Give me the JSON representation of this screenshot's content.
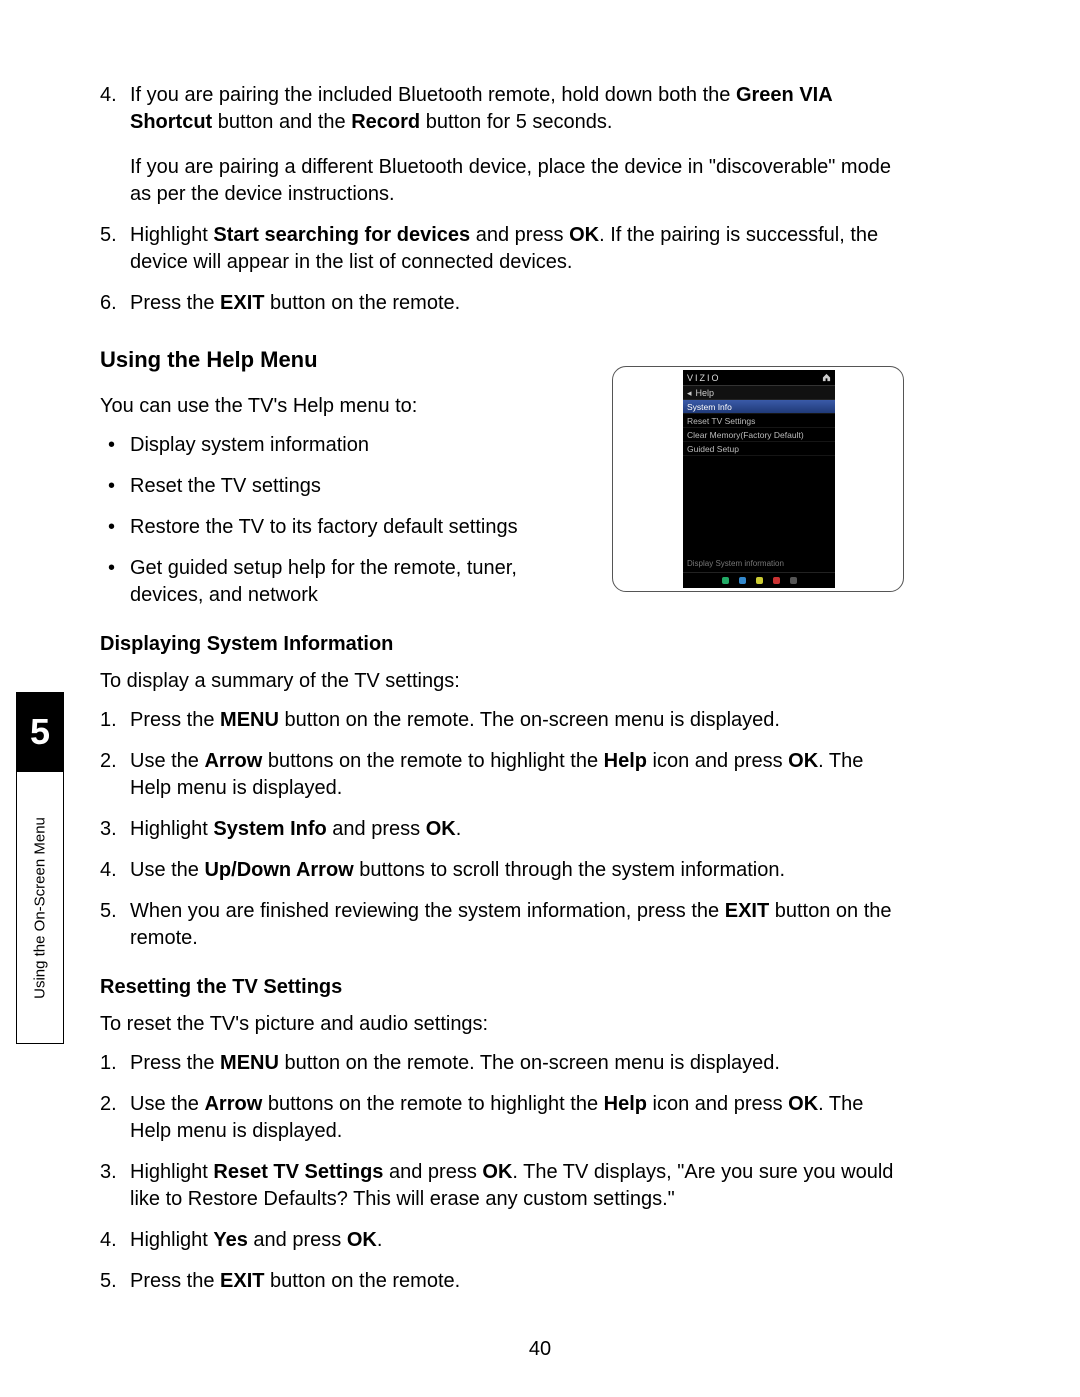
{
  "side": {
    "chapter": "5",
    "label": "Using the On-Screen Menu"
  },
  "steps_top": [
    {
      "n": "4.",
      "text": "If you are pairing the included Bluetooth remote, hold down both the ",
      "b1": "Green VIA Shortcut",
      "mid": " button and the ",
      "b2": "Record",
      "tail": " button for 5 seconds."
    },
    {
      "plain": "If you are pairing a different Bluetooth device, place the device in \"discoverable\" mode as per the device instructions."
    },
    {
      "n": "5.",
      "text": "Highlight ",
      "b1": "Start searching for devices",
      "mid": " and press ",
      "b2": "OK",
      "tail": ". If the pairing is successful, the device will appear in the list of connected devices."
    },
    {
      "n": "6.",
      "text": "Press the ",
      "b1": "EXIT",
      "tail": " button on the remote."
    }
  ],
  "help_heading": "Using the Help Menu",
  "help_intro": "You can use the TV's Help menu to:",
  "help_bullets": [
    "Display system information",
    "Reset the TV settings",
    "Restore the TV to its factory default settings",
    "Get guided setup help for the remote, tuner, devices, and network"
  ],
  "sys_heading": "Displaying System Information",
  "sys_intro": "To display a summary of the TV settings:",
  "sys_steps": [
    {
      "n": "1.",
      "pre": "Press the ",
      "b1": "MENU",
      "post": " button on the remote. The on-screen menu is displayed."
    },
    {
      "n": "2.",
      "pre": "Use the ",
      "b1": "Arrow",
      "mid": " buttons on the remote to highlight the ",
      "b2": "Help",
      "mid2": " icon and press ",
      "b3": "OK",
      "post": ". The Help menu is displayed."
    },
    {
      "n": "3.",
      "pre": "Highlight ",
      "b1": "System Info",
      "mid": " and press ",
      "b2": "OK",
      "post": "."
    },
    {
      "n": "4.",
      "pre": "Use the ",
      "b1": "Up/Down Arrow",
      "post": " buttons to scroll through the system information."
    },
    {
      "n": "5.",
      "pre": "When you are finished reviewing the system information, press the ",
      "b1": "EXIT",
      "post": " button on the remote."
    }
  ],
  "reset_heading": "Resetting the TV Settings",
  "reset_intro": "To reset the TV's picture and audio settings:",
  "reset_steps": [
    {
      "n": "1.",
      "pre": "Press the ",
      "b1": "MENU",
      "post": " button on the remote. The on-screen menu is displayed."
    },
    {
      "n": "2.",
      "pre": "Use the ",
      "b1": "Arrow",
      "mid": " buttons on the remote to highlight the ",
      "b2": "Help",
      "mid2": " icon and press ",
      "b3": "OK",
      "post": ". The Help menu is displayed."
    },
    {
      "n": "3.",
      "pre": "Highlight ",
      "b1": "Reset TV Settings",
      "mid": " and press ",
      "b2": "OK",
      "post": ". The TV displays, \"Are you sure you would like to Restore Defaults? This will erase any custom settings.\""
    },
    {
      "n": "4.",
      "pre": "Highlight ",
      "b1": "Yes",
      "mid": " and press ",
      "b2": "OK",
      "post": "."
    },
    {
      "n": "5.",
      "pre": "Press the ",
      "b1": "EXIT",
      "post": " button on the remote."
    }
  ],
  "tv": {
    "brand": "VIZIO",
    "crumb": "Help",
    "rows": [
      "System Info",
      "Reset TV Settings",
      "Clear Memory(Factory Default)",
      "Guided Setup"
    ],
    "desc": "Display System information"
  },
  "page_number": "40"
}
